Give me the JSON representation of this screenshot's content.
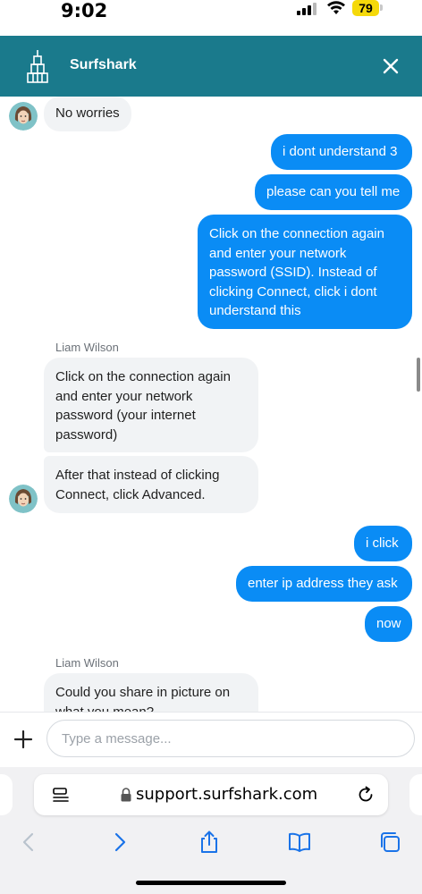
{
  "status": {
    "time": "9:02",
    "battery": "79"
  },
  "header": {
    "brand": "Surfshark"
  },
  "chat": {
    "messages": [
      {
        "from": "agent",
        "text": "No worries"
      },
      {
        "from": "user",
        "text": "i dont understand 3"
      },
      {
        "from": "user",
        "text": "please can you tell me"
      },
      {
        "from": "user",
        "text": "Click on the connection again and enter your network password (SSID). Instead of clicking Connect, click i dont understand this"
      },
      {
        "from": "sender",
        "text": "Liam Wilson"
      },
      {
        "from": "agent",
        "text": "Click on the connection again and enter your network password (your internet password)"
      },
      {
        "from": "agent",
        "text": "After that instead of clicking Connect, click Advanced."
      },
      {
        "from": "user",
        "text": "i click"
      },
      {
        "from": "user",
        "text": "enter ip address they ask"
      },
      {
        "from": "user",
        "text": "now"
      },
      {
        "from": "sender",
        "text": "Liam Wilson"
      },
      {
        "from": "agent",
        "text": "Could you share in picture on what you mean?"
      }
    ]
  },
  "composer": {
    "placeholder": "Type a message..."
  },
  "browser": {
    "url": "support.surfshark.com"
  },
  "colors": {
    "header": "#1a7a8c",
    "user_bubble": "#0a8cf5",
    "agent_bubble": "#f1f3f5",
    "battery": "#f5d90a"
  }
}
